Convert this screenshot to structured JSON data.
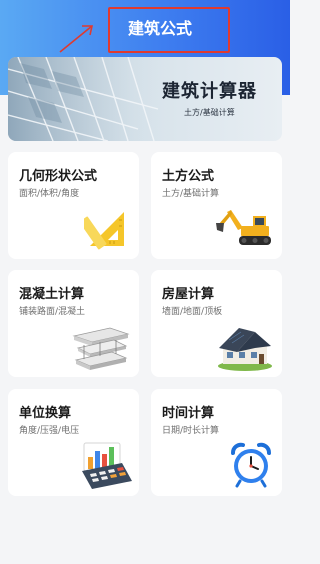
{
  "header": {
    "title": "建筑公式"
  },
  "banner": {
    "title": "建筑计算器",
    "subtitle": "土方/基础计算"
  },
  "cards": [
    {
      "title": "几何形状公式",
      "subtitle": "面积/体积/角度",
      "icon": "set-square-icon"
    },
    {
      "title": "土方公式",
      "subtitle": "土方/基础计算",
      "icon": "excavator-icon"
    },
    {
      "title": "混凝土计算",
      "subtitle": "铺装路面/混凝土",
      "icon": "concrete-building-icon"
    },
    {
      "title": "房屋计算",
      "subtitle": "墙面/地面/顶板",
      "icon": "house-icon"
    },
    {
      "title": "单位换算",
      "subtitle": "角度/压强/电压",
      "icon": "calculator-chart-icon"
    },
    {
      "title": "时间计算",
      "subtitle": "日期/时长计算",
      "icon": "alarm-clock-icon"
    }
  ],
  "colors": {
    "header_start": "#5aa9f3",
    "header_end": "#2a5fe6",
    "annotation": "#e03a2f",
    "background": "#f4f5f7",
    "card": "#ffffff"
  }
}
